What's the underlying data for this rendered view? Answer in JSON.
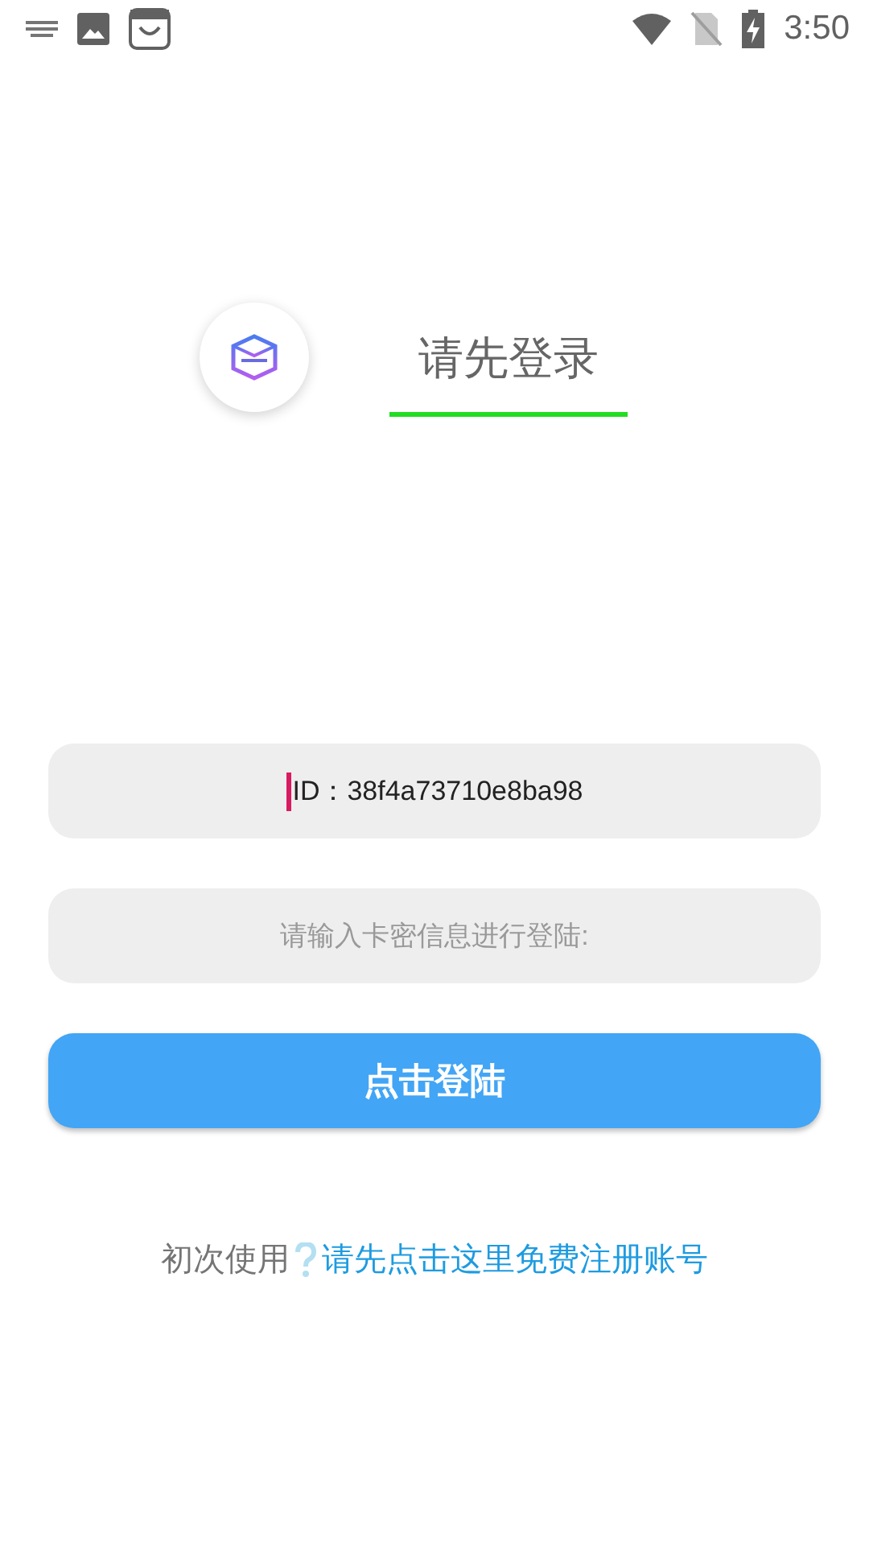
{
  "status_bar": {
    "time": "3:50"
  },
  "header": {
    "title": "请先登录"
  },
  "fields": [
    {
      "kind": "value",
      "value": "ID：38f4a73710e8ba98",
      "focused": true
    },
    {
      "kind": "placeholder",
      "placeholder": "请输入卡密信息进行登陆:",
      "focused": false
    }
  ],
  "login_button": {
    "label": "点击登陆"
  },
  "footer": {
    "prompt": "初次使用",
    "link": "请先点击这里免费注册账号"
  }
}
